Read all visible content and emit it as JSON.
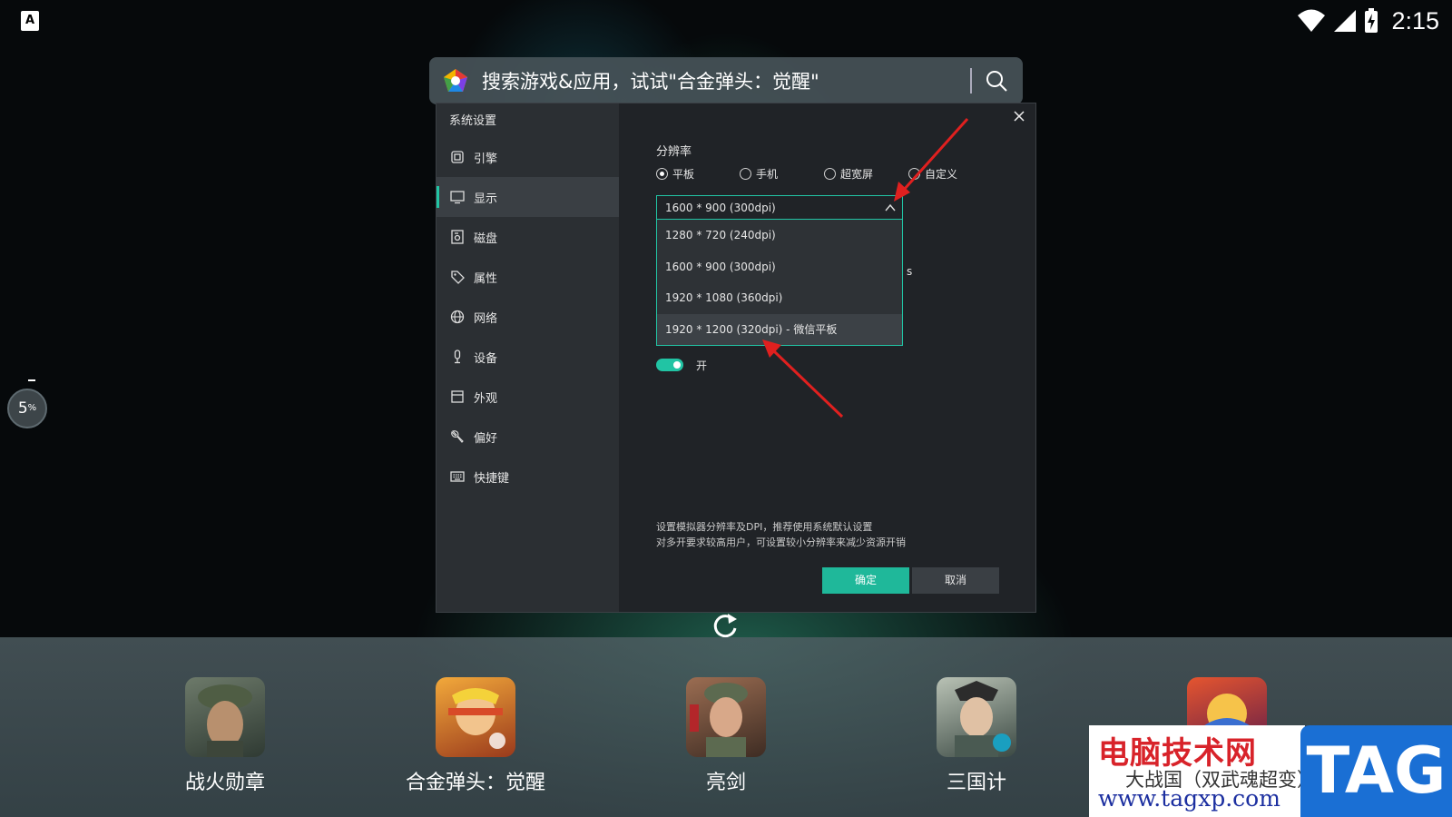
{
  "status_bar": {
    "keyboard_indicator": "A",
    "time": "2:15",
    "icons": [
      "wifi-icon",
      "signal-icon",
      "battery-charging-icon"
    ]
  },
  "search": {
    "placeholder": "搜索游戏&应用，试试\"合金弹头：觉醒\""
  },
  "side_indicator": {
    "value": "5",
    "unit": "%"
  },
  "dialog": {
    "title": "系统设置",
    "nav": [
      {
        "label": "引擎",
        "icon": "chip-icon"
      },
      {
        "label": "显示",
        "icon": "monitor-icon",
        "active": true
      },
      {
        "label": "磁盘",
        "icon": "disk-icon"
      },
      {
        "label": "属性",
        "icon": "tag-icon"
      },
      {
        "label": "网络",
        "icon": "globe-icon"
      },
      {
        "label": "设备",
        "icon": "microphone-icon"
      },
      {
        "label": "外观",
        "icon": "window-icon"
      },
      {
        "label": "偏好",
        "icon": "wrench-icon"
      },
      {
        "label": "快捷键",
        "icon": "keyboard-icon"
      }
    ],
    "resolution_label": "分辨率",
    "radio_options": [
      {
        "label": "平板",
        "checked": true
      },
      {
        "label": "手机",
        "checked": false
      },
      {
        "label": "超宽屏",
        "checked": false
      },
      {
        "label": "自定义",
        "checked": false
      }
    ],
    "selected_resolution": "1600 * 900 (300dpi)",
    "dropdown_options": [
      "1280 * 720 (240dpi)",
      "1600 * 900 (300dpi)",
      "1920 * 1080 (360dpi)",
      "1920 * 1200 (320dpi) - 微信平板"
    ],
    "partially_hidden_text": "s",
    "toggle": {
      "on": true,
      "label": "开"
    },
    "description_lines": [
      "设置模拟器分辨率及DPI，推荐使用系统默认设置",
      "对多开要求较高用户，可设置较小分辨率来减少资源开销"
    ],
    "ok_label": "确定",
    "cancel_label": "取消"
  },
  "dock": {
    "apps": [
      {
        "label": "战火勋章",
        "color": "#4b5a4c"
      },
      {
        "label": "合金弹头：觉醒",
        "color": "#d9862c"
      },
      {
        "label": "亮剑",
        "color": "#7a5a44"
      },
      {
        "label": "三国计",
        "color": "#5a6d62"
      },
      {
        "label": "",
        "color": "#c74a2a"
      }
    ]
  },
  "watermark": {
    "title": "电脑技术网",
    "subtitle": "大战国（双武魂超变）",
    "url": "www.tagxp.com",
    "tag": "TAG"
  },
  "colors": {
    "accent": "#21c4a4",
    "arrow": "#e0201f",
    "dialog_bg": "#202327",
    "sidebar_bg": "#2b2f33"
  }
}
